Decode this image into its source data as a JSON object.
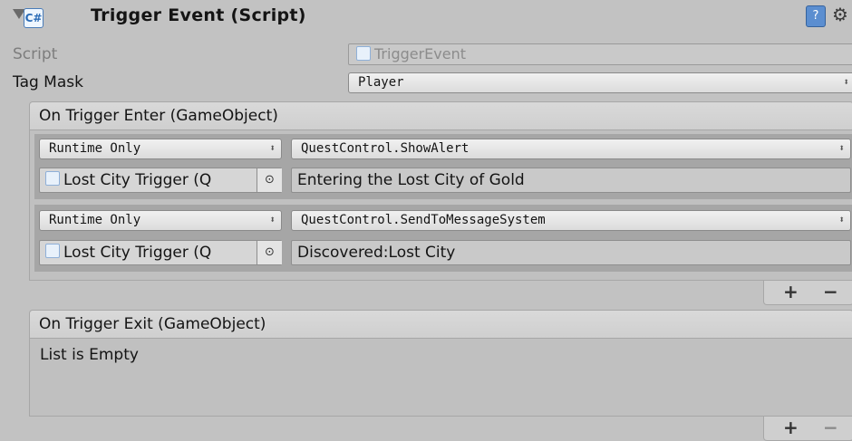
{
  "component": {
    "title": "Trigger Event (Script)"
  },
  "props": {
    "script_label": "Script",
    "script_value": "TriggerEvent",
    "tagmask_label": "Tag Mask",
    "tagmask_value": "Player"
  },
  "enter": {
    "header": "On Trigger Enter (GameObject)",
    "entries": [
      {
        "mode": "Runtime Only",
        "method": "QuestControl.ShowAlert",
        "target": "Lost City Trigger (Q",
        "argument": "Entering the Lost City of Gold"
      },
      {
        "mode": "Runtime Only",
        "method": "QuestControl.SendToMessageSystem",
        "target": "Lost City Trigger (Q",
        "argument": "Discovered:Lost City"
      }
    ],
    "add_label": "+",
    "remove_label": "−"
  },
  "exit": {
    "header": "On Trigger Exit (GameObject)",
    "empty_text": "List is Empty",
    "add_label": "+",
    "remove_label": "−"
  },
  "icons": [
    "foldout-arrow-icon",
    "script-icon",
    "help-icon",
    "gear-icon",
    "object-picker-icon",
    "dropdown-arrow-icon"
  ],
  "colors": {
    "background": "#c2c2c2",
    "entry_background": "#a6a6a6",
    "help_icon": "#5b8ed0"
  }
}
